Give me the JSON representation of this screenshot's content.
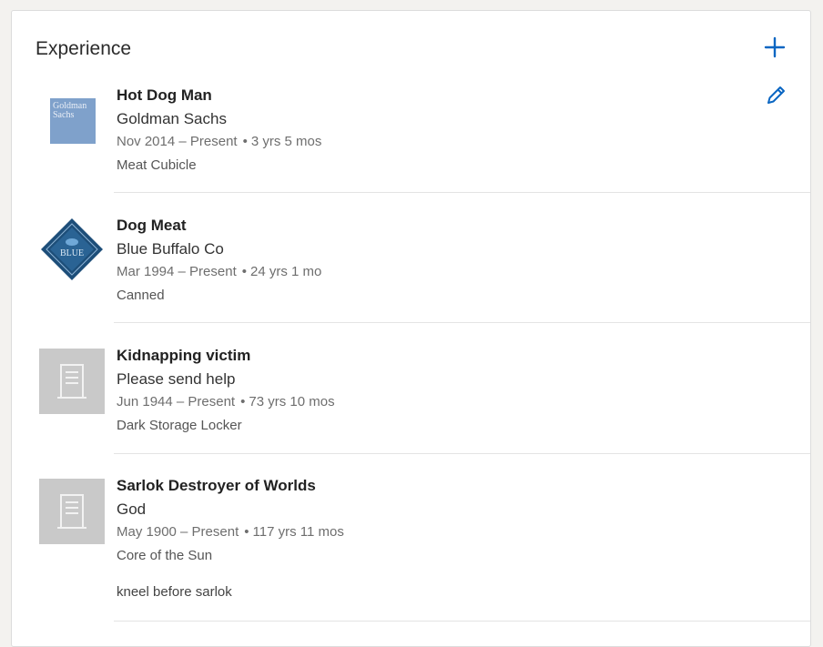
{
  "section": {
    "title": "Experience"
  },
  "actions": {
    "add_icon": "plus-icon",
    "edit_icon": "pencil-icon"
  },
  "colors": {
    "accent": "#0a66c2",
    "goldman_logo_bg": "#7fa1cb",
    "blue_buffalo_logo": "#1d4e79",
    "placeholder_logo_bg": "#c9c9c9"
  },
  "entries": [
    {
      "title": "Hot Dog Man",
      "company": "Goldman Sachs",
      "date_range": "Nov 2014 – Present",
      "duration": "3 yrs 5 mos",
      "location": "Meat Cubicle",
      "description": "",
      "logo": {
        "type": "goldman-sachs-logo",
        "text_line1": "Goldman",
        "text_line2": "Sachs"
      }
    },
    {
      "title": "Dog Meat",
      "company": "Blue Buffalo Co",
      "date_range": "Mar 1994 – Present",
      "duration": "24 yrs 1 mo",
      "location": "Canned",
      "description": "",
      "logo": {
        "type": "blue-buffalo-logo",
        "text": "BLUE"
      }
    },
    {
      "title": "Kidnapping victim",
      "company": "Please send help",
      "date_range": "Jun 1944 – Present",
      "duration": "73 yrs 10 mos",
      "location": "Dark Storage Locker",
      "description": "",
      "logo": {
        "type": "building-placeholder-icon"
      }
    },
    {
      "title": "Sarlok Destroyer of Worlds",
      "company": "God",
      "date_range": "May 1900 – Present",
      "duration": "117 yrs 11 mos",
      "location": "Core of the Sun",
      "description": "kneel before sarlok",
      "logo": {
        "type": "building-placeholder-icon"
      }
    }
  ],
  "separator": "•"
}
